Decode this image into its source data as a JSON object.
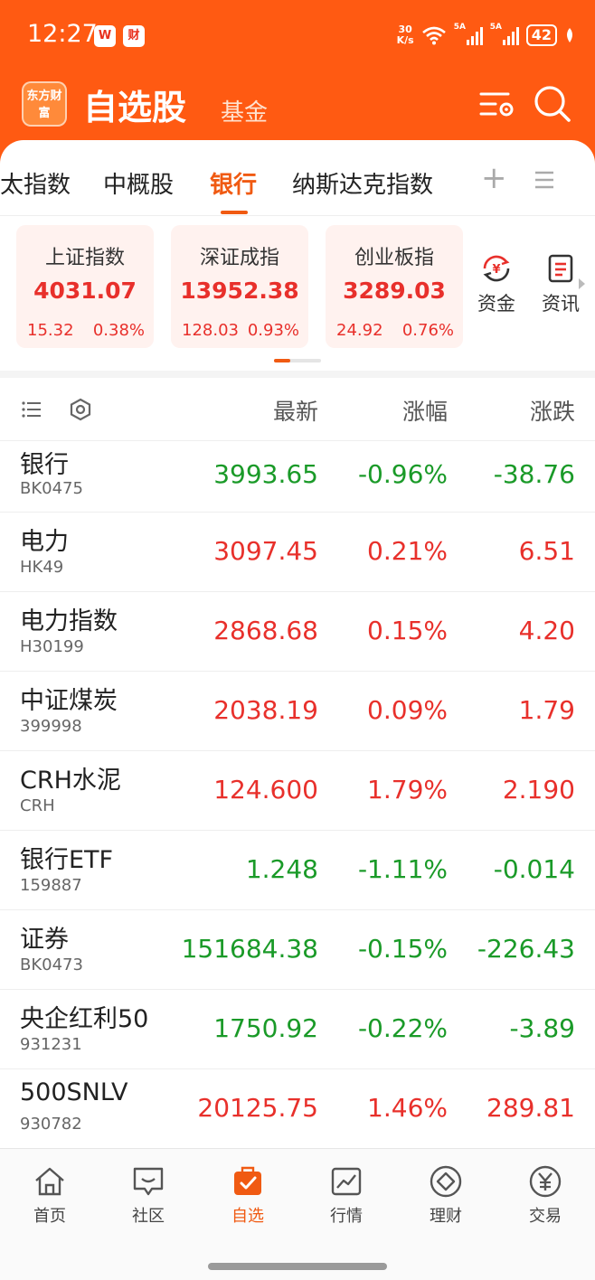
{
  "status_bar": {
    "time": "12:27",
    "app_badge_1": "W",
    "app_badge_2": "财",
    "net_speed_value": "30",
    "net_speed_unit": "K/s",
    "signal_1_label": "5A",
    "signal_2_label": "5A",
    "battery": "42"
  },
  "header": {
    "logo_text": "东方财富",
    "title": "自选股",
    "secondary_link": "基金"
  },
  "tabs": {
    "items": [
      "太指数",
      "中概股",
      "银行",
      "纳斯达克指数"
    ],
    "active_index": 2,
    "add_symbol": "+"
  },
  "index_cards": [
    {
      "name": "上证指数",
      "value": "4031.07",
      "change": "15.32",
      "pct": "0.38%"
    },
    {
      "name": "深证成指",
      "value": "13952.38",
      "change": "128.03",
      "pct": "0.93%"
    },
    {
      "name": "创业板指",
      "value": "3289.03",
      "change": "24.92",
      "pct": "0.76%"
    }
  ],
  "quick_actions": [
    {
      "label": "资金",
      "icon": "yuan-flow-icon"
    },
    {
      "label": "资讯",
      "icon": "news-icon"
    }
  ],
  "table": {
    "headers": {
      "latest": "最新",
      "pct": "涨幅",
      "change": "涨跌"
    },
    "rows": [
      {
        "name": "银行",
        "code": "BK0475",
        "latest": "3993.65",
        "pct": "-0.96%",
        "change": "-38.76",
        "dir": "down"
      },
      {
        "name": "电力",
        "code": "HK49",
        "latest": "3097.45",
        "pct": "0.21%",
        "change": "6.51",
        "dir": "up"
      },
      {
        "name": "电力指数",
        "code": "H30199",
        "latest": "2868.68",
        "pct": "0.15%",
        "change": "4.20",
        "dir": "up"
      },
      {
        "name": "中证煤炭",
        "code": "399998",
        "latest": "2038.19",
        "pct": "0.09%",
        "change": "1.79",
        "dir": "up"
      },
      {
        "name": "CRH水泥",
        "code": "CRH",
        "latest": "124.600",
        "pct": "1.79%",
        "change": "2.190",
        "dir": "up"
      },
      {
        "name": "银行ETF",
        "code": "159887",
        "latest": "1.248",
        "pct": "-1.11%",
        "change": "-0.014",
        "dir": "down"
      },
      {
        "name": "证券",
        "code": "BK0473",
        "latest": "151684.38",
        "pct": "-0.15%",
        "change": "-226.43",
        "dir": "down"
      },
      {
        "name": "央企红利50",
        "code": "931231",
        "latest": "1750.92",
        "pct": "-0.22%",
        "change": "-3.89",
        "dir": "down"
      },
      {
        "name": "500SNLV",
        "code": "930782",
        "latest": "20125.75",
        "pct": "1.46%",
        "change": "289.81",
        "dir": "up"
      }
    ]
  },
  "bottom_nav": [
    {
      "label": "首页",
      "icon": "home-icon"
    },
    {
      "label": "社区",
      "icon": "community-icon"
    },
    {
      "label": "自选",
      "icon": "watchlist-icon"
    },
    {
      "label": "行情",
      "icon": "market-chart-icon"
    },
    {
      "label": "理财",
      "icon": "wealth-icon"
    },
    {
      "label": "交易",
      "icon": "trade-yuan-icon"
    }
  ],
  "colors": {
    "brand": "#ff5a12",
    "accent": "#f05a12",
    "up": "#e8302b",
    "down": "#1a9a28"
  }
}
